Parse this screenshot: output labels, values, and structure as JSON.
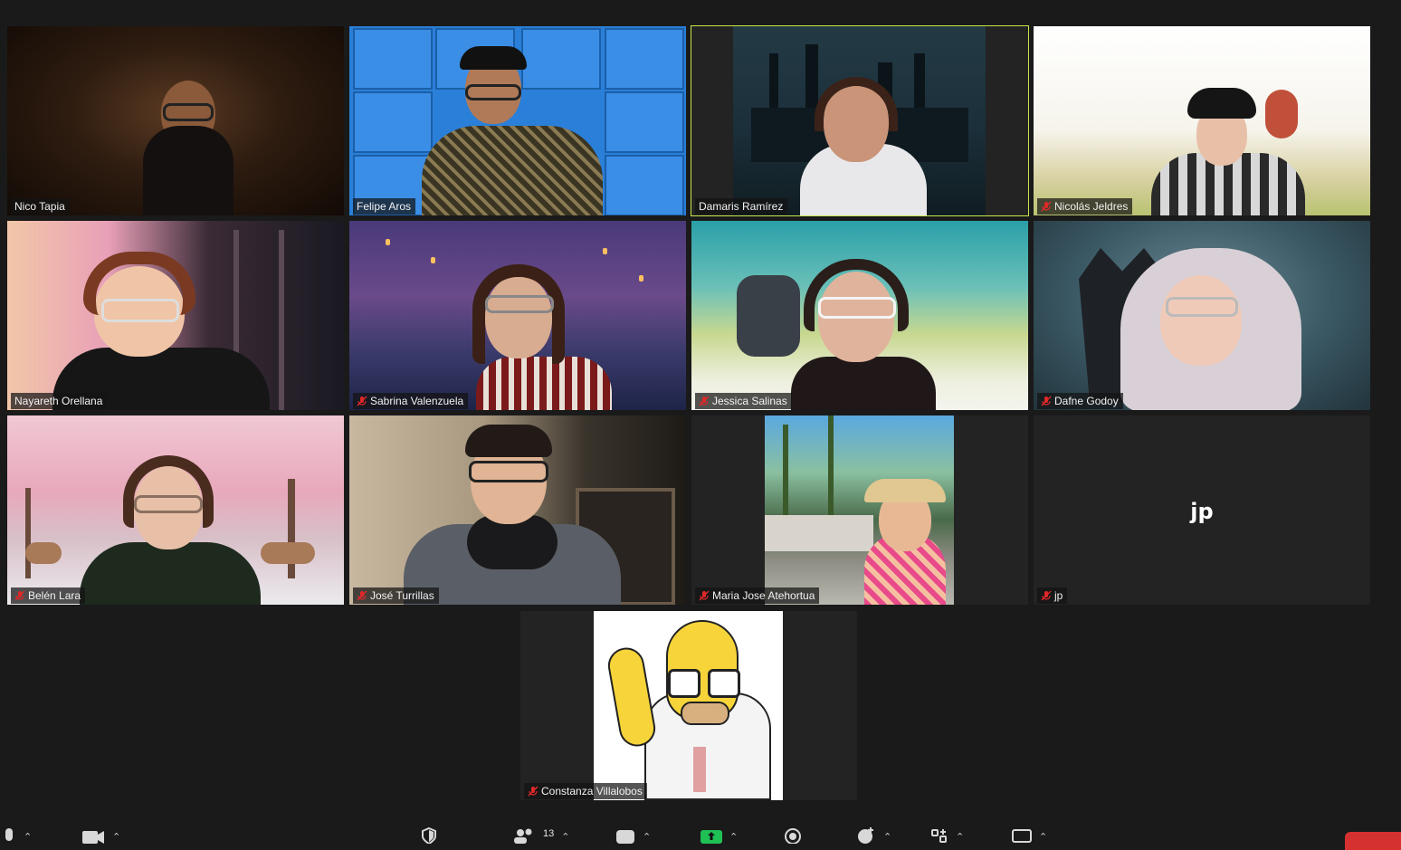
{
  "participants": [
    {
      "name": "Nico Tapia",
      "muted": false
    },
    {
      "name": "Felipe Aros",
      "muted": false
    },
    {
      "name": "Damaris Ramírez",
      "muted": false,
      "active_speaker": true
    },
    {
      "name": "Nicolás Jeldres",
      "muted": true
    },
    {
      "name": "Nayareth Orellana",
      "muted": false
    },
    {
      "name": "Sabrina Valenzuela",
      "muted": true
    },
    {
      "name": "Jessica Salinas",
      "muted": true
    },
    {
      "name": "Dafne Godoy",
      "muted": true
    },
    {
      "name": "Belén Lara",
      "muted": true
    },
    {
      "name": "José Turrillas",
      "muted": true
    },
    {
      "name": "Maria Jose Atehortua",
      "muted": true
    },
    {
      "name": "jp",
      "muted": true,
      "initials": "jp"
    },
    {
      "name": "Constanza Villalobos",
      "muted": true
    }
  ],
  "toolbar": {
    "participants_count": "13",
    "icons": [
      "microphone-icon",
      "video-camera-icon",
      "security-shield-icon",
      "participants-icon",
      "chat-icon",
      "share-screen-icon",
      "record-icon",
      "reactions-icon",
      "apps-icon",
      "whiteboard-icon"
    ]
  },
  "colors": {
    "background": "#1a1a1a",
    "active_speaker_border": "#c6e84a",
    "share_green": "#1fc155",
    "muted_red": "#e02828",
    "end_red": "#d53131"
  }
}
